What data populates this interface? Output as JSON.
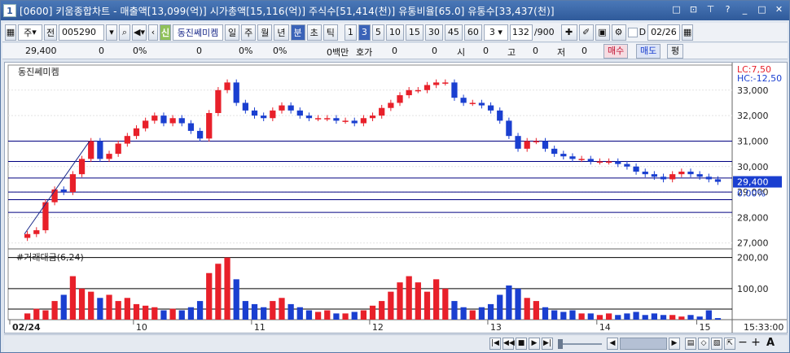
{
  "window": {
    "number": "1",
    "title": "[0600] 키움종합차트 - 매출액[13,099(억)] 시가총액[15,116(억)] 주식수[51,414(천)] 유통비율[65.0] 유통수[33,437(천)]",
    "controls": [
      "□",
      "⊡",
      "⊤",
      "?",
      "_",
      "□",
      "✕"
    ]
  },
  "toolbar": {
    "period_label": "주",
    "period2_label": "전",
    "code": "005290",
    "stock_badge": "신",
    "stock_name": "동진쎄미켐",
    "tabs": [
      "일",
      "주",
      "월",
      "년",
      "분",
      "초",
      "틱"
    ],
    "active_tab": "분",
    "minutes": [
      "1",
      "3",
      "5",
      "10",
      "15",
      "30",
      "45",
      "60"
    ],
    "active_minute": "3",
    "interval": "3",
    "count": "132",
    "count_max": "/900",
    "d_label": "D",
    "date": "02/26"
  },
  "quote": {
    "price": "29,400",
    "v1": "0",
    "p1": "0%",
    "v2": "0",
    "p2": "0%",
    "p3": "0%",
    "unit": "0백만",
    "hoga_label": "호가",
    "hoga": "0",
    "v3": "0",
    "si_label": "시",
    "si": "0",
    "go_label": "고",
    "go": "0",
    "jeo_label": "저",
    "jeo": "0",
    "buy": "매수",
    "sell": "매도",
    "eval": "평"
  },
  "chart": {
    "stock_label": "동진쎄미켐",
    "lc": "LC:7,50",
    "hc": "HC:-12,50",
    "current_price": "29,400",
    "current_pct": "0.00%",
    "price_ticks": [
      "33,000",
      "32,000",
      "31,000",
      "30,000",
      "29,000",
      "28,000",
      "27,000"
    ],
    "volume_title": "#거래대금(6,24)",
    "volume_ticks": [
      "200,00",
      "100,00"
    ],
    "date_labels": [
      "02/24",
      "10",
      "11",
      "12",
      "13",
      "14",
      "15"
    ],
    "time_label": "15:33:00",
    "colors": {
      "up": "#e8202a",
      "down": "#1a3fd0",
      "grid": "#000080",
      "line": "#1a2a8a"
    }
  },
  "chart_data": {
    "type": "candlestick",
    "title": "동진쎄미켐",
    "ylim": [
      26800,
      33600
    ],
    "x": [
      "02/24",
      "10",
      "11",
      "12",
      "13",
      "14",
      "15"
    ],
    "close_series": [
      27350,
      27500,
      28600,
      29100,
      29000,
      29700,
      30300,
      31000,
      30300,
      30500,
      30900,
      31200,
      31500,
      31800,
      32000,
      31700,
      31900,
      31700,
      31400,
      31100,
      32100,
      33000,
      33300,
      32500,
      32200,
      32000,
      31900,
      32200,
      32400,
      32200,
      32000,
      31900,
      31900,
      31900,
      31800,
      31800,
      31700,
      31900,
      32000,
      32300,
      32500,
      32800,
      33000,
      33000,
      33200,
      33300,
      33300,
      32700,
      32500,
      32500,
      32400,
      32200,
      31800,
      31200,
      30700,
      31000,
      31000,
      30700,
      30500,
      30400,
      30300,
      30300,
      30200,
      30200,
      30200,
      30100,
      30000,
      29800,
      29700,
      29600,
      29500,
      29700,
      29800,
      29700,
      29600,
      29500,
      29400
    ],
    "volume_series": [
      20,
      35,
      30,
      60,
      80,
      140,
      100,
      90,
      70,
      80,
      60,
      70,
      50,
      45,
      40,
      30,
      35,
      30,
      40,
      60,
      150,
      180,
      200,
      130,
      60,
      50,
      40,
      60,
      70,
      50,
      40,
      30,
      25,
      30,
      20,
      20,
      25,
      30,
      45,
      60,
      90,
      120,
      140,
      120,
      90,
      130,
      100,
      60,
      40,
      30,
      40,
      50,
      80,
      110,
      100,
      70,
      60,
      40,
      30,
      25,
      30,
      20,
      20,
      15,
      20,
      15,
      20,
      25,
      15,
      20,
      15,
      15,
      10,
      15,
      10,
      30,
      5
    ]
  }
}
